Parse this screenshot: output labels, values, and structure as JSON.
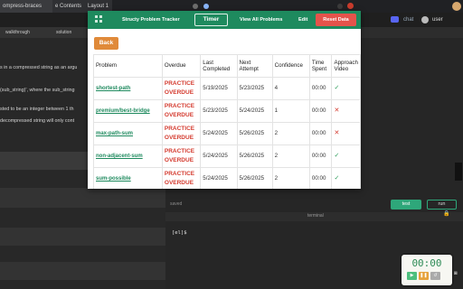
{
  "browser": {
    "tabs": [
      "ompress-braces",
      "e Contents",
      "Layout 1"
    ],
    "discord_label": "chat",
    "user_label": "user"
  },
  "left_panel": {
    "tabs": [
      "walkthrough",
      "solution"
    ],
    "lines": [
      "s in a compressed string as an argu",
      "(sub_string)', where the sub_string",
      "sted to be an integer between 1 th",
      "decompressed string will only cont"
    ]
  },
  "editor": {
    "saved_label": "saved",
    "test_label": "test",
    "run_label": "run",
    "terminal_title": "terminal",
    "terminal_prompt": "[el]$"
  },
  "timer_widget": {
    "time": "00:00",
    "buttons": [
      "▶",
      "❚❚",
      "↺"
    ]
  },
  "tracker": {
    "title": "Structy Problem Tracker",
    "timer_button": "Timer",
    "view_all_button": "View All Problems",
    "edit_button": "Edit",
    "reset_button": "Reset Data",
    "back_button": "Back",
    "columns": [
      "Problem",
      "Overdue",
      "Last Completed",
      "Next Attempt",
      "Confidence",
      "Time Spent",
      "Approach Video"
    ],
    "rows": [
      {
        "problem": "shortest-path",
        "overdue": "PRACTICE OVERDUE",
        "last": "5/19/2025",
        "next": "5/23/2025",
        "confidence": "4",
        "time": "00:00",
        "video": "check"
      },
      {
        "problem": "premium/best-bridge",
        "overdue": "PRACTICE OVERDUE",
        "last": "5/23/2025",
        "next": "5/24/2025",
        "confidence": "1",
        "time": "00:00",
        "video": "cross"
      },
      {
        "problem": "max-path-sum",
        "overdue": "PRACTICE OVERDUE",
        "last": "5/24/2025",
        "next": "5/26/2025",
        "confidence": "2",
        "time": "00:00",
        "video": "cross"
      },
      {
        "problem": "non-adjacent-sum",
        "overdue": "PRACTICE OVERDUE",
        "last": "5/24/2025",
        "next": "5/26/2025",
        "confidence": "2",
        "time": "00:00",
        "video": "check"
      },
      {
        "problem": "sum-possible",
        "overdue": "PRACTICE OVERDUE",
        "last": "5/24/2025",
        "next": "5/26/2025",
        "confidence": "2",
        "time": "00:00",
        "video": "check"
      }
    ],
    "colors": {
      "header": "#1e8a5e",
      "reset": "#e5534b",
      "back": "#e08a3a",
      "overdue": "#d43a2e"
    }
  }
}
